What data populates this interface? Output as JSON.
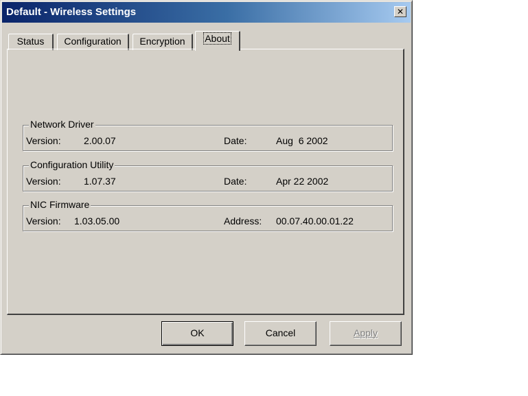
{
  "window": {
    "title": "Default - Wireless Settings",
    "close_glyph": "✕"
  },
  "tabs": [
    {
      "label": "Status"
    },
    {
      "label": "Configuration"
    },
    {
      "label": "Encryption"
    },
    {
      "label": "About",
      "active": true
    }
  ],
  "groups": [
    {
      "title": "Network Driver",
      "version_label": "Version:",
      "version": "2.00.07",
      "second_label": "Date:",
      "second_value": "Aug  6 2002"
    },
    {
      "title": "Configuration Utility",
      "version_label": "Version:",
      "version": "1.07.37",
      "second_label": "Date:",
      "second_value": "Apr 22 2002"
    },
    {
      "title": "NIC Firmware",
      "version_label": "Version:",
      "version": "1.03.05.00",
      "second_label": "Address:",
      "second_value": "00.07.40.00.01.22"
    }
  ],
  "buttons": {
    "ok": "OK",
    "cancel": "Cancel",
    "apply": "Apply",
    "apply_enabled": false
  },
  "colors": {
    "titlebar_start": "#0a246a",
    "titlebar_end": "#a6caf0",
    "face": "#d4d0c8"
  }
}
